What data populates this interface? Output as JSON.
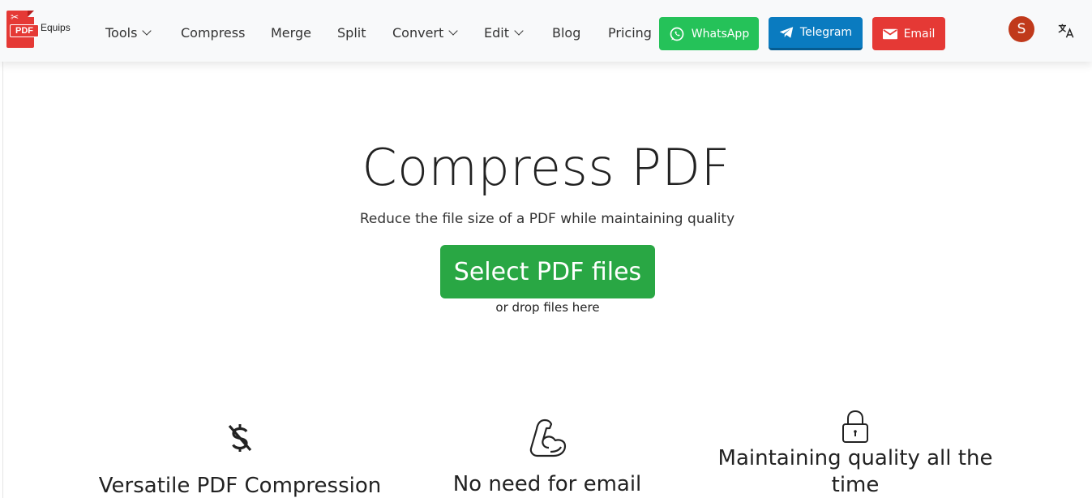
{
  "brand": {
    "logo_tag": "PDF",
    "name": "Equips"
  },
  "nav": {
    "tools": "Tools",
    "compress": "Compress",
    "merge": "Merge",
    "split": "Split",
    "convert": "Convert",
    "edit": "Edit",
    "blog": "Blog",
    "pricing": "Pricing"
  },
  "contact": {
    "whatsapp": "WhatsApp",
    "telegram": "Telegram",
    "email": "Email"
  },
  "user": {
    "avatar_letter": "S"
  },
  "hero": {
    "title": "Compress PDF",
    "subtitle": "Reduce the file size of a PDF while maintaining quality",
    "select_button": "Select PDF files",
    "drop_hint": "or drop files here"
  },
  "features": [
    {
      "icon": "dollar-off-icon",
      "title": "Versatile PDF Compression"
    },
    {
      "icon": "flexed-arm-icon",
      "title": "No need for email"
    },
    {
      "icon": "lock-icon",
      "title": "Maintaining quality all the time"
    }
  ],
  "colors": {
    "whatsapp": "#25c259",
    "telegram": "#0a7bc0",
    "email": "#e53935",
    "select_button": "#29a744",
    "avatar": "#c0391b"
  }
}
